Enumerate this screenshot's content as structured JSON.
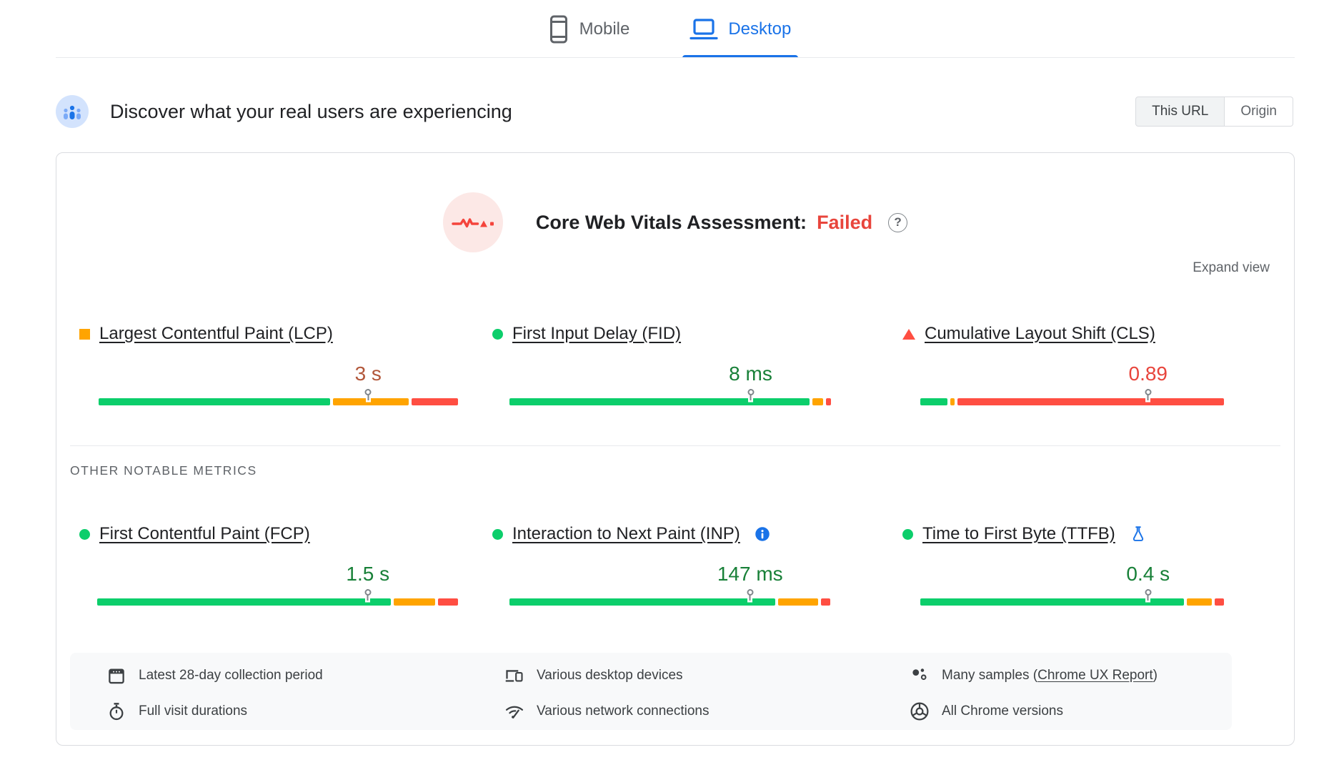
{
  "tabs": {
    "mobile": "Mobile",
    "desktop": "Desktop"
  },
  "header": {
    "title": "Discover what your real users are experiencing",
    "scope": {
      "this_url": "This URL",
      "origin": "Origin"
    }
  },
  "assessment": {
    "title": "Core Web Vitals Assessment:",
    "result": "Failed",
    "help_glyph": "?",
    "expand_view": "Expand view"
  },
  "sections": {
    "other_metrics": "OTHER NOTABLE METRICS"
  },
  "metrics": [
    {
      "id": "lcp",
      "label": "Largest Contentful Paint (LCP)",
      "value": "3 s",
      "status": "average",
      "bullet": "square",
      "segments": [
        64.5,
        21,
        13
      ],
      "marker_pct": 75
    },
    {
      "id": "fid",
      "label": "First Input Delay (FID)",
      "value": "8 ms",
      "status": "good",
      "bullet": "circle",
      "segments": [
        94,
        3.5,
        1.5
      ],
      "marker_pct": 75
    },
    {
      "id": "cls",
      "label": "Cumulative Layout Shift (CLS)",
      "value": "0.89",
      "status": "poor",
      "bullet": "triangle",
      "segments": [
        9,
        1.5,
        88
      ],
      "marker_pct": 75
    },
    {
      "id": "fcp",
      "label": "First Contentful Paint (FCP)",
      "value": "1.5 s",
      "status": "good",
      "bullet": "circle",
      "segments": [
        81,
        11.5,
        5.5
      ],
      "marker_pct": 75
    },
    {
      "id": "inp",
      "label": "Interaction to Next Paint (INP)",
      "value": "147 ms",
      "status": "good",
      "bullet": "circle",
      "segments": [
        83,
        12.5,
        3
      ],
      "marker_pct": 75
    },
    {
      "id": "ttfb",
      "label": "Time to First Byte (TTFB)",
      "value": "0.4 s",
      "status": "good",
      "bullet": "circle",
      "segments": [
        88,
        8.5,
        3
      ],
      "marker_pct": 75
    }
  ],
  "colors": {
    "bar": {
      "good": "#0cce6b",
      "average": "#ffa400",
      "poor": "#ff4e42"
    },
    "text": {
      "good": "#188038",
      "average": "#b2573a",
      "poor": "#e8453c"
    },
    "accent_blue": "#1a73e8",
    "failed_red": "#e8453c"
  },
  "icons": {
    "mobile": "phone-outline",
    "desktop": "laptop-outline",
    "field_data": "users-chart",
    "assessment": "pulse-line",
    "inp_extra": "info-filled",
    "ttfb_extra": "experiment-flask",
    "footer": [
      "calendar",
      "stopwatch",
      "devices",
      "network-signal",
      "sample-dots",
      "chrome-logo"
    ]
  },
  "footer": {
    "collection_period": "Latest 28-day collection period",
    "visit_durations": "Full visit durations",
    "devices": "Various desktop devices",
    "network": "Various network connections",
    "samples_prefix": "Many samples (",
    "samples_link": "Chrome UX Report",
    "samples_suffix": ")",
    "chrome_versions": "All Chrome versions"
  }
}
